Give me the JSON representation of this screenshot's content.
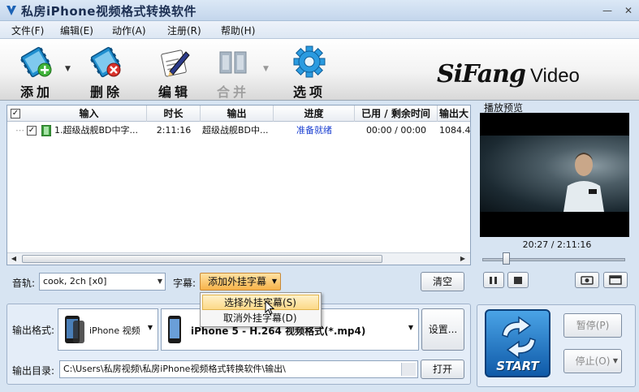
{
  "window": {
    "title": "私房iPhone视频格式转换软件",
    "minimize_glyph": "—",
    "close_glyph": "✕"
  },
  "menu": [
    {
      "label": "文件(F)"
    },
    {
      "label": "编辑(E)"
    },
    {
      "label": "动作(A)"
    },
    {
      "label": "注册(R)"
    },
    {
      "label": "帮助(H)"
    }
  ],
  "toolbar": {
    "add": "添加",
    "delete": "删除",
    "edit": "编辑",
    "merge": "合并",
    "options": "选项"
  },
  "brand": {
    "main": "SiFang",
    "sub": "Video"
  },
  "file_list": {
    "columns": [
      "输入",
      "时长",
      "输出",
      "进度",
      "已用 / 剩余时间",
      "输出大"
    ],
    "rows": [
      {
        "input": "1.超级战舰BD中字...",
        "duration": "2:11:16",
        "output": "超级战舰BD中...",
        "progress": "准备就绪",
        "time": "00:00 / 00:00",
        "size": "1084.4"
      }
    ]
  },
  "audio": {
    "label": "音轨:",
    "value": "cook, 2ch [x0]"
  },
  "subtitle": {
    "label": "字幕:",
    "button": "添加外挂字幕",
    "menu": [
      "选择外挂字幕(S)",
      "取消外挂字幕(D)"
    ]
  },
  "clear_button": "清空",
  "output": {
    "format_label": "输出格式:",
    "category": "iPhone 视频",
    "profile": "iPhone 5 - H.264 视频格式(*.mp4)",
    "settings_button": "设置...",
    "dir_label": "输出目录:",
    "dir_value": "C:\\Users\\私房视频\\私房iPhone视频格式转换软件\\输出\\",
    "open_button": "打开"
  },
  "preview": {
    "title": "播放预览",
    "time": "20:27 / 2:11:16",
    "position_fraction": 0.17
  },
  "start": {
    "label": "START",
    "pause": "暂停(P)",
    "stop": "停止(O)"
  },
  "colors": {
    "accent": "#f7b34a",
    "progress_text": "#1a3fd1",
    "start_blue": "#0f5aa8"
  }
}
